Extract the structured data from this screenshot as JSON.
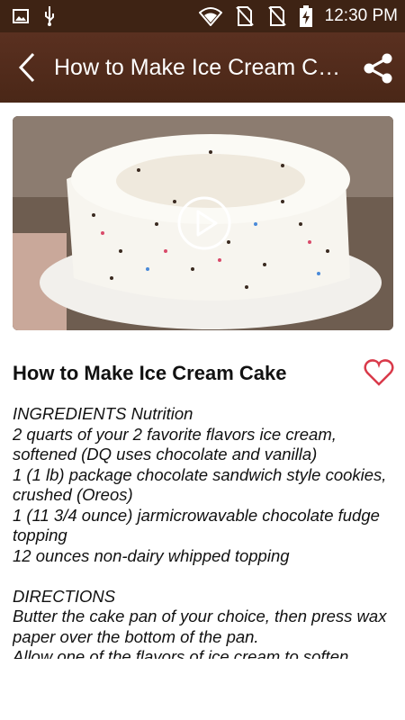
{
  "status_bar": {
    "time": "12:30 PM"
  },
  "app_bar": {
    "title": "How to Make Ice Cream Cake"
  },
  "recipe": {
    "title": "How to Make Ice Cream Cake",
    "ingredients_heading": "INGREDIENTS Nutrition",
    "ingredients": [
      "2 quarts of your 2 favorite flavors ice cream, softened (DQ uses chocolate and vanilla)",
      "1 (1 lb) package chocolate sandwich style cookies, crushed (Oreos)",
      "1 (11 3/4 ounce) jarmicrowavable chocolate fudge topping",
      "12 ounces non-dairy whipped topping"
    ],
    "directions_heading": "DIRECTIONS",
    "directions": [
      "Butter the cake pan of your choice, then press wax paper over the bottom of the pan.",
      "Allow one of the flavors of ice cream to soften"
    ]
  },
  "colors": {
    "app_bar": "#4a2717",
    "status_bar": "#3e2314",
    "favorite": "#d93a4a"
  }
}
